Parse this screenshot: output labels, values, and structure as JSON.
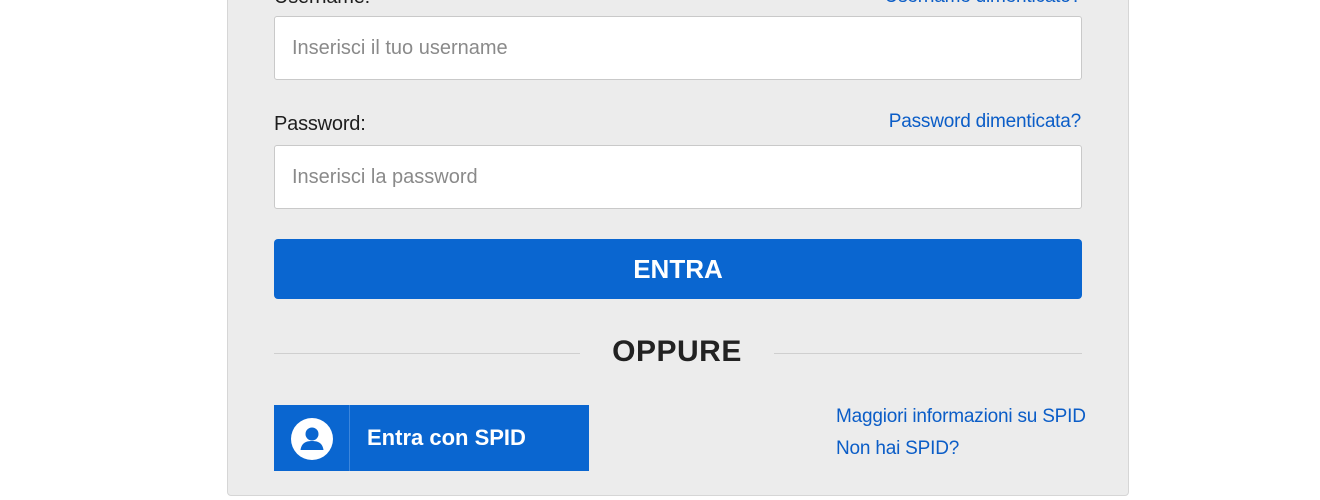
{
  "colors": {
    "accent": "#0a66d0",
    "link": "#0b5dc7",
    "panel": "#ececec"
  },
  "login": {
    "username_label": "Username:",
    "username_forgot": "Username dimenticato?",
    "username_placeholder": "Inserisci il tuo username",
    "password_label": "Password:",
    "password_forgot": "Password dimenticata?",
    "password_placeholder": "Inserisci la password",
    "submit_label": "ENTRA",
    "divider_text": "OPPURE"
  },
  "spid": {
    "button_label": "Entra con SPID",
    "icon": "user-icon",
    "more_info_link": "Maggiori informazioni su SPID",
    "no_spid_link": "Non hai SPID?"
  }
}
